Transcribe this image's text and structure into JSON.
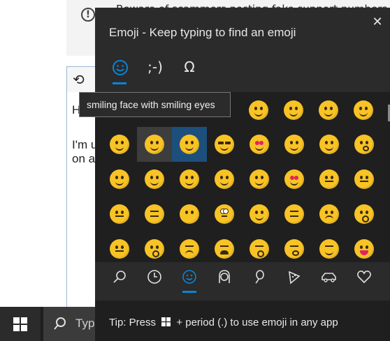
{
  "background": {
    "warning_text": "Beware of scammers posting fake support numbers",
    "editor_lines": [
      "Hi",
      "I'm u",
      "on a"
    ],
    "taskbar_search_placeholder": "Type"
  },
  "panel": {
    "title": "Emoji - Keep typing to find an emoji",
    "close_glyph": "✕",
    "tabs": [
      {
        "icon": "smiley-icon",
        "label": "☺"
      },
      {
        "icon": "kaomoji-icon",
        "label": ";-)"
      },
      {
        "icon": "symbols-icon",
        "label": "Ω"
      }
    ],
    "tooltip": "smiling face with smiling eyes",
    "emoji_rows": [
      [
        "",
        "",
        "",
        "😃",
        "😄",
        "😅",
        "😆"
      ],
      [
        "😉",
        "😊",
        "😋",
        "😎",
        "😍",
        "😘",
        "🥰",
        "😗"
      ],
      [
        "😙",
        "😚",
        "☺️",
        "🙂",
        "🤗",
        "🤩",
        "🤔",
        "🤨"
      ],
      [
        "😐",
        "😑",
        "😶",
        "🙄",
        "😏",
        "😣",
        "😥",
        "😮"
      ],
      [
        "🤐",
        "😯",
        "😪",
        "😫",
        "😴",
        "😌",
        "😛"
      ]
    ],
    "categories": [
      "search-icon",
      "recent-icon",
      "smiley-icon",
      "people-icon",
      "celebration-icon",
      "food-icon",
      "travel-icon",
      "heart-icon"
    ],
    "tip": {
      "prefix": "Tip: Press",
      "suffix": "+ period (.) to use emoji in any app"
    }
  }
}
